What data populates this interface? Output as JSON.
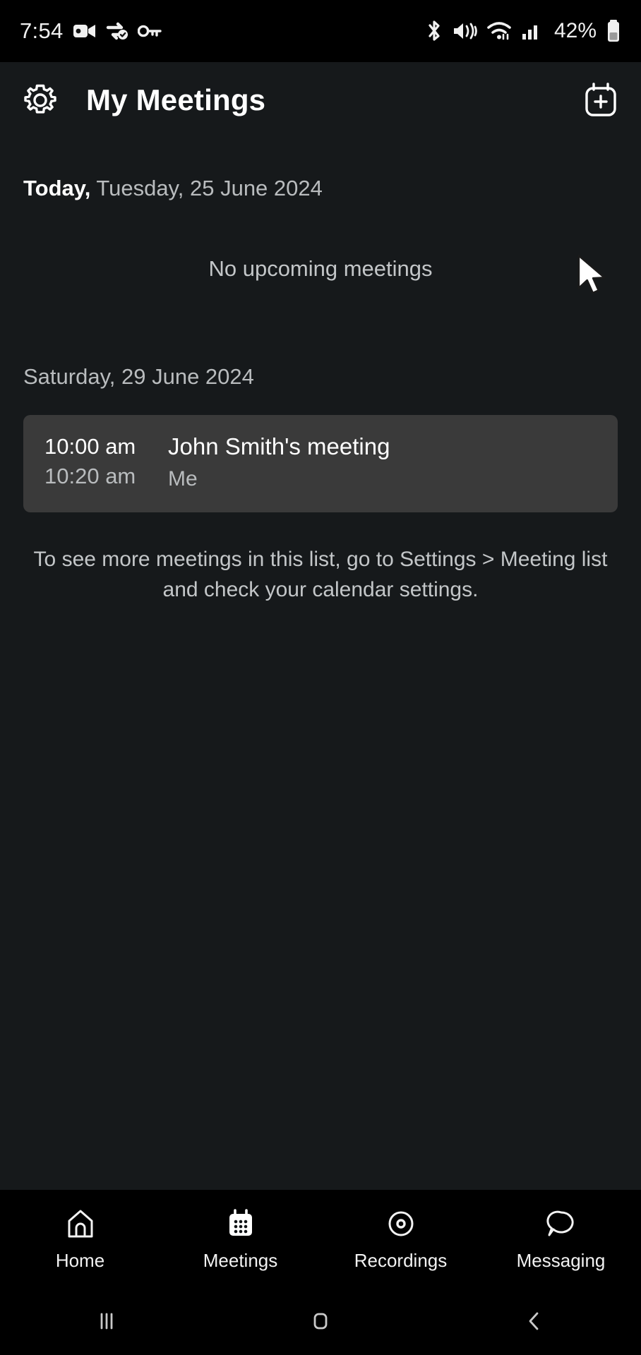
{
  "status_bar": {
    "time": "7:54",
    "battery_text": "42%",
    "left_icons": [
      "video-camera-icon",
      "vpn-sync-icon",
      "key-icon"
    ],
    "right_icons": [
      "bluetooth-icon",
      "mute-vibrate-icon",
      "wifi-icon",
      "cellular-signal-icon",
      "battery-icon"
    ]
  },
  "header": {
    "title": "My Meetings",
    "settings_icon": "gear-icon",
    "add_meeting_icon": "calendar-plus-icon"
  },
  "main": {
    "today_label": "Today,",
    "today_date": "Tuesday, 25 June 2024",
    "empty_state": "No upcoming meetings",
    "later_date": "Saturday, 29 June 2024",
    "meeting": {
      "start_time": "10:00 am",
      "end_time": "10:20 am",
      "title": "John Smith's meeting",
      "host": "Me"
    },
    "hint": "To see more meetings in this list, go to Settings > Meeting list and check your calendar settings."
  },
  "tabs": [
    {
      "label": "Home",
      "icon": "home-icon",
      "active": false
    },
    {
      "label": "Meetings",
      "icon": "calendar-icon",
      "active": true
    },
    {
      "label": "Recordings",
      "icon": "record-circle-icon",
      "active": false
    },
    {
      "label": "Messaging",
      "icon": "chat-bubble-icon",
      "active": false
    }
  ],
  "system_nav": {
    "recents": "recents-icon",
    "home": "home-square-icon",
    "back": "back-chevron-icon"
  },
  "colors": {
    "page_background": "#16191b",
    "bar_background": "#000000",
    "card_background": "#3a3a3a",
    "primary_text": "#ffffff",
    "secondary_text": "#b9bcbe"
  }
}
